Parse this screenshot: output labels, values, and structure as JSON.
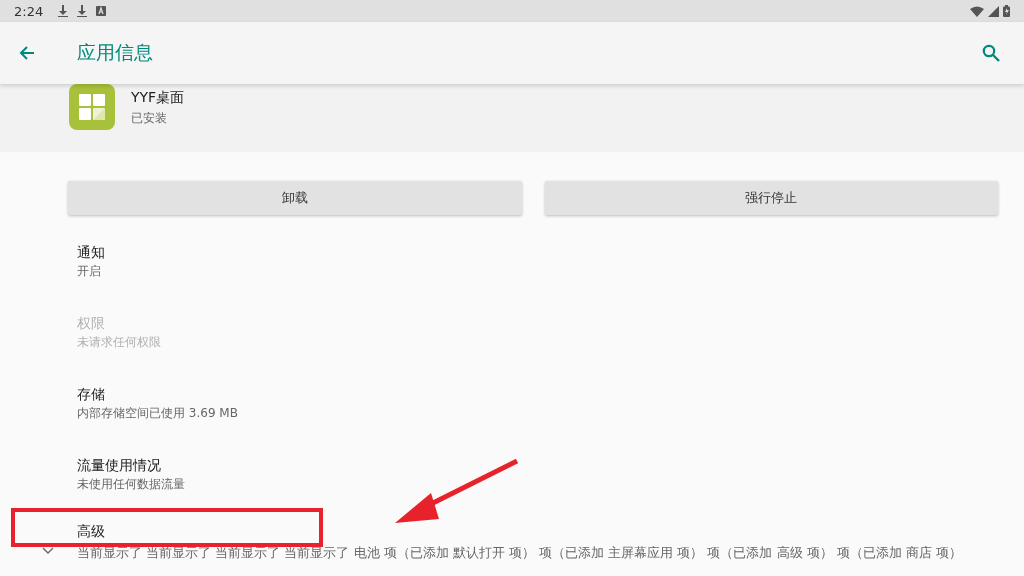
{
  "status_bar": {
    "time": "2:24",
    "notifications": [
      {
        "kind": "download"
      },
      {
        "kind": "download"
      },
      {
        "kind": "text-a"
      }
    ]
  },
  "app_bar": {
    "title": "应用信息"
  },
  "app": {
    "name": "YYF桌面",
    "status": "已安装"
  },
  "buttons": [
    {
      "label": "卸载"
    },
    {
      "label": "强行停止"
    }
  ],
  "items": [
    {
      "title": "通知",
      "summary": "开启",
      "disabled": false
    },
    {
      "title": "权限",
      "summary": "未请求任何权限",
      "disabled": true
    },
    {
      "title": "存储",
      "summary": "内部存储空间已使用 3.69 MB",
      "disabled": false
    },
    {
      "title": "流量使用情况",
      "summary": "未使用任何数据流量",
      "disabled": false
    }
  ],
  "advanced": {
    "title": "高级",
    "summary": "当前显示了 当前显示了 当前显示了 当前显示了 电池 项（已添加 默认打开 项） 项（已添加 主屏幕应用 项） 项（已添加 高级 项） 项（已添加 商店 项）",
    "expanded": false
  }
}
